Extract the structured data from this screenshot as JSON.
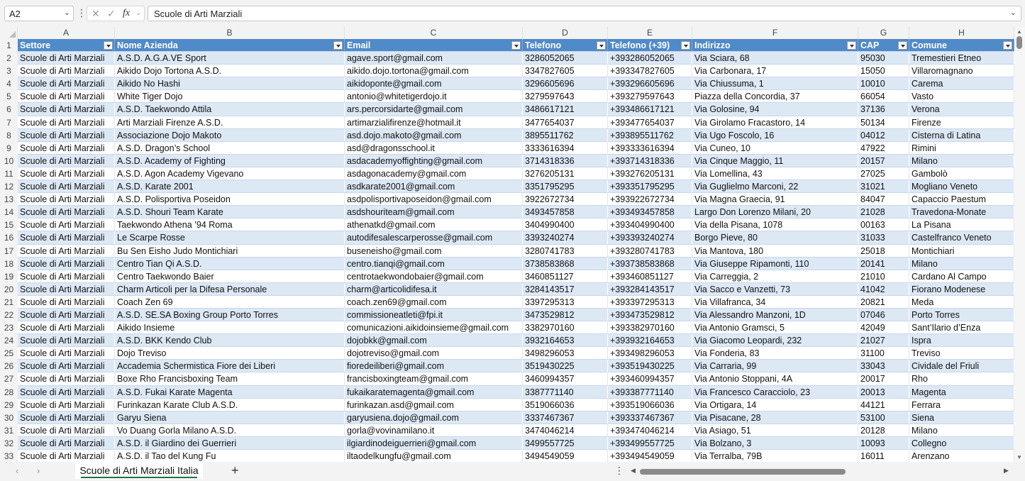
{
  "formula_bar": {
    "name_box": "A2",
    "cancel_glyph": "✕",
    "confirm_glyph": "✓",
    "fx_label": "fx",
    "content": "Scuole di Arti Marziali"
  },
  "column_letters": [
    "A",
    "B",
    "C",
    "D",
    "E",
    "F",
    "G",
    "H"
  ],
  "table": {
    "headers": [
      "Settore",
      "Nome Azienda",
      "Email",
      "Telefono",
      "Telefono (+39)",
      "Indirizzo",
      "CAP",
      "Comune"
    ],
    "rows": [
      [
        "Scuole di Arti Marziali",
        "A.S.D. A.G.A.VE Sport",
        "agave.sport@gmail.com",
        "3286052065",
        "+393286052065",
        "Via Sciara, 68",
        "95030",
        "Tremestieri Etneo"
      ],
      [
        "Scuole di Arti Marziali",
        "Aikido Dojo Tortona A.S.D.",
        "aikido.dojo.tortona@gmail.com",
        "3347827605",
        "+393347827605",
        "Via Carbonara, 17",
        "15050",
        "Villaromagnano"
      ],
      [
        "Scuole di Arti Marziali",
        "Aikido No Hashi",
        "aikidoponte@gmail.com",
        "3296605696",
        "+393296605696",
        "Via Chiussuma, 1",
        "10010",
        "Carema"
      ],
      [
        "Scuole di Arti Marziali",
        "White Tiger Dojo",
        "antonio@whitetigerdojo.it",
        "3279597643",
        "+393279597643",
        "Piazza della Concordia, 37",
        "66054",
        "Vasto"
      ],
      [
        "Scuole di Arti Marziali",
        "A.S.D. Taekwondo Attila",
        "ars.percorsidarte@gmail.com",
        "3486617121",
        "+393486617121",
        "Via Golosine, 94",
        "37136",
        "Verona"
      ],
      [
        "Scuole di Arti Marziali",
        "Arti Marziali Firenze A.S.D.",
        "artimarzialifirenze@hotmail.it",
        "3477654037",
        "+393477654037",
        "Via Girolamo Fracastoro, 14",
        "50134",
        "Firenze"
      ],
      [
        "Scuole di Arti Marziali",
        "Associazione Dojo Makoto",
        "asd.dojo.makoto@gmail.com",
        "3895511762",
        "+393895511762",
        "Via Ugo Foscolo, 16",
        "04012",
        "Cisterna di Latina"
      ],
      [
        "Scuole di Arti Marziali",
        "A.S.D. Dragon’s School",
        "asd@dragonsschool.it",
        "3333616394",
        "+393333616394",
        "Via Cuneo, 10",
        "47922",
        "Rimini"
      ],
      [
        "Scuole di Arti Marziali",
        "A.S.D. Academy of Fighting",
        "asdacademyoffighting@gmail.com",
        "3714318336",
        "+393714318336",
        "Via Cinque Maggio, 11",
        "20157",
        "Milano"
      ],
      [
        "Scuole di Arti Marziali",
        "A.S.D. Agon Academy Vigevano",
        "asdagonacademy@gmail.com",
        "3276205131",
        "+393276205131",
        "Via Lomellina, 43",
        "27025",
        "Gambolò"
      ],
      [
        "Scuole di Arti Marziali",
        "A.S.D. Karate 2001",
        "asdkarate2001@gmail.com",
        "3351795295",
        "+393351795295",
        "Via Guglielmo Marconi, 22",
        "31021",
        "Mogliano Veneto"
      ],
      [
        "Scuole di Arti Marziali",
        "A.S.D. Polisportiva Poseidon",
        "asdpolisportivaposeidon@gmail.com",
        "3922672734",
        "+393922672734",
        "Via Magna Graecia, 91",
        "84047",
        "Capaccio Paestum"
      ],
      [
        "Scuole di Arti Marziali",
        "A.S.D. Shouri Team Karate",
        "asdshouriteam@gmail.com",
        "3493457858",
        "+393493457858",
        "Largo Don Lorenzo Milani, 20",
        "21028",
        "Travedona-Monate"
      ],
      [
        "Scuole di Arti Marziali",
        "Taekwondo Athena ’94 Roma",
        "athenatkd@gmail.com",
        "3404990400",
        "+393404990400",
        "Via della Pisana, 1078",
        "00163",
        "La Pisana"
      ],
      [
        "Scuole di Arti Marziali",
        "Le Scarpe Rosse",
        "autodifesalescarperosse@gmail.com",
        "3393240274",
        "+393393240274",
        "Borgo Pieve, 80",
        "31033",
        "Castelfranco Veneto"
      ],
      [
        "Scuole di Arti Marziali",
        "Bu Sen Eisho Judo Montichiari",
        "buseneisho@gmail.com",
        "3280741783",
        "+393280741783",
        "Via Mantova, 180",
        "25018",
        "Montichiari"
      ],
      [
        "Scuole di Arti Marziali",
        "Centro Tian Qi A.S.D.",
        "centro.tianqi@gmail.com",
        "3738583868",
        "+393738583868",
        "Via Giuseppe Ripamonti, 110",
        "20141",
        "Milano"
      ],
      [
        "Scuole di Arti Marziali",
        "Centro Taekwondo Baier",
        "centrotaekwondobaier@gmail.com",
        "3460851127",
        "+393460851127",
        "Via Carreggia, 2",
        "21010",
        "Cardano Al Campo"
      ],
      [
        "Scuole di Arti Marziali",
        "Charm Articoli per la Difesa Personale",
        "charm@articolidifesa.it",
        "3284143517",
        "+393284143517",
        "Via Sacco e Vanzetti, 73",
        "41042",
        "Fiorano Modenese"
      ],
      [
        "Scuole di Arti Marziali",
        "Coach Zen 69",
        "coach.zen69@gmail.com",
        "3397295313",
        "+393397295313",
        "Via Villafranca, 34",
        "20821",
        "Meda"
      ],
      [
        "Scuole di Arti Marziali",
        "A.S.D. SE.SA Boxing Group Porto Torres",
        "commissioneatleti@fpi.it",
        "3473529812",
        "+393473529812",
        "Via Alessandro Manzoni, 1D",
        "07046",
        "Porto Torres"
      ],
      [
        "Scuole di Arti Marziali",
        "Aikido Insieme",
        "comunicazioni.aikidoinsieme@gmail.com",
        "3382970160",
        "+393382970160",
        "Via Antonio Gramsci, 5",
        "42049",
        "Sant’Ilario d’Enza"
      ],
      [
        "Scuole di Arti Marziali",
        "A.S.D. BKK Kendo Club",
        "dojobkk@gmail.com",
        "3932164653",
        "+393932164653",
        "Via Giacomo Leopardi, 232",
        "21027",
        "Ispra"
      ],
      [
        "Scuole di Arti Marziali",
        "Dojo Treviso",
        "dojotreviso@gmail.com",
        "3498296053",
        "+393498296053",
        "Via Fonderia, 83",
        "31100",
        "Treviso"
      ],
      [
        "Scuole di Arti Marziali",
        "Accademia Schermistica Fiore dei Liberi",
        "fioredeiliberi@gmail.com",
        "3519430225",
        "+393519430225",
        "Via Carraria, 99",
        "33043",
        "Cividale del Friuli"
      ],
      [
        "Scuole di Arti Marziali",
        "Boxe Rho Francisboxing Team",
        "francisboxingteam@gmail.com",
        "3460994357",
        "+393460994357",
        "Via Antonio Stoppani, 4A",
        "20017",
        "Rho"
      ],
      [
        "Scuole di Arti Marziali",
        "A.S.D. Fukai Karate Magenta",
        "fukaikaratemagenta@gmail.com",
        "3387771140",
        "+393387771140",
        "Via Francesco Caracciolo, 23",
        "20013",
        "Magenta"
      ],
      [
        "Scuole di Arti Marziali",
        "Furinkazan Karate Club A.S.D.",
        "furinkazan.asd@gmail.com",
        "3519066036",
        "+393519066036",
        "Via Ortigara, 14",
        "44121",
        "Ferrara"
      ],
      [
        "Scuole di Arti Marziali",
        "Garyu Siena",
        "garyusiena.dojo@gmail.com",
        "3337467367",
        "+393337467367",
        "Via Pisacane, 28",
        "53100",
        "Siena"
      ],
      [
        "Scuole di Arti Marziali",
        "Vo Duang Gorla Milano A.S.D.",
        "gorla@vovinamilano.it",
        "3474046214",
        "+393474046214",
        "Via Asiago, 51",
        "20128",
        "Milano"
      ],
      [
        "Scuole di Arti Marziali",
        "A.S.D. il Giardino dei Guerrieri",
        "ilgiardinodeiguerrieri@gmail.com",
        "3499557725",
        "+393499557725",
        "Via Bolzano, 3",
        "10093",
        "Collegno"
      ],
      [
        "Scuole di Arti Marziali",
        "A.S.D. il Tao del Kung Fu",
        "iltaodelkungfu@gmail.com",
        "3494549059",
        "+393494549059",
        "Via Terralba, 79B",
        "16011",
        "Arenzano"
      ]
    ]
  },
  "sheet_tab": "Scuole di Arti Marziali Italia",
  "add_sheet_glyph": "+",
  "colors": {
    "header_bg": "#4f8ac9",
    "band_bg": "#dde8f5",
    "active_tab_underline": "#1e7145"
  }
}
